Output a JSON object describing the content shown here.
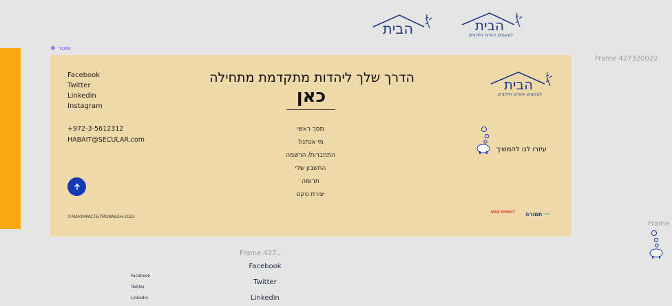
{
  "header_logos": [
    {
      "name": "הבית"
    },
    {
      "name": "הבית",
      "tagline": "לטקסים יהודים חילוניים"
    }
  ],
  "frames": {
    "footer_label": "❖ פוטר",
    "right_frame": "Frame 427320022",
    "bottom_frame": "Frame 427...",
    "edge_frame": "Frame"
  },
  "footer": {
    "logo_name": "הבית",
    "logo_tagline": "לטקסים יהודים חילוניים",
    "title_line1": "הדרך שלך ליהדות מתקדמת מתחילה",
    "title_line2": "כאן",
    "social": [
      "Facebook",
      "Twitter",
      "Linkedin",
      "Instagram"
    ],
    "phone": "+972-3-5612312",
    "email": "HABAIT@SECULAR.com",
    "nav": [
      "מסך ראשי",
      "מי אנחנו?",
      "התחברות/ הרשמה",
      "החשבון שלי",
      "תרומה",
      "יצירת טקס"
    ],
    "donate_text": "עיזרו לנו להמשיך",
    "copyright": "©MAXIMPACT&TMURA&SH-2023",
    "partners": [
      "MAX IMPACT",
      "תמורה"
    ],
    "up_icon": "arrow-up-icon"
  },
  "bottom_links": [
    "Facebook",
    "Twitter",
    "Linkedin"
  ],
  "small_links": [
    "Facebook",
    "Twitter",
    "Linkedin"
  ],
  "colors": {
    "accent_blue": "#1538b5",
    "footer_bg": "#f0d9a8",
    "orange": "#f8a810"
  }
}
